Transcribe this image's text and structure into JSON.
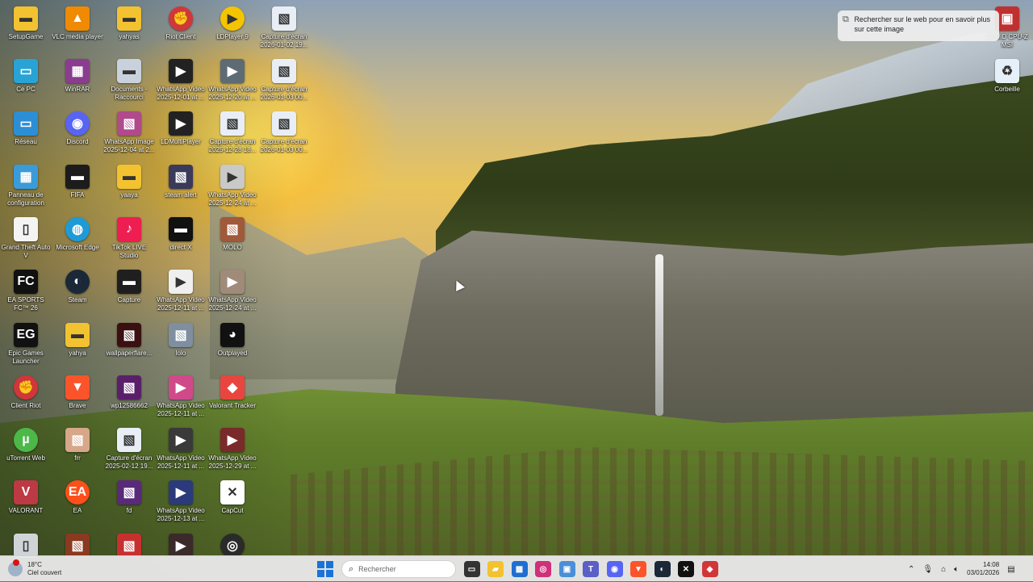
{
  "desktop": {
    "icons": [
      {
        "label": "SetupGame",
        "glyph": "folder-icon",
        "color": "#f2c230"
      },
      {
        "label": "VLC media player",
        "glyph": "vlc-icon",
        "color": "#f08a00"
      },
      {
        "label": "yahyas",
        "glyph": "folder-icon",
        "color": "#f2c230"
      },
      {
        "label": "Riot Client",
        "glyph": "riot-icon",
        "color": "#d13639"
      },
      {
        "label": "LDPlayer 9",
        "glyph": "ldplayer-icon",
        "color": "#f5c400"
      },
      {
        "label": "Capture d'écran 2026-01-02 19...",
        "glyph": "image-icon",
        "color": "#e9eef6"
      },
      {
        "label": "Ce PC",
        "glyph": "monitor-icon",
        "color": "#29a3d6"
      },
      {
        "label": "WinRAR",
        "glyph": "winrar-icon",
        "color": "#8a3d8e"
      },
      {
        "label": "Documents - Raccourci",
        "glyph": "folder-icon",
        "color": "#c9d2dc"
      },
      {
        "label": "WhatsApp Video 2025-12-01 at ...",
        "glyph": "video-icon",
        "color": "#222222"
      },
      {
        "label": "WhatsApp Video 2025-12-20 at ...",
        "glyph": "video-icon",
        "color": "#5f6b74"
      },
      {
        "label": "Capture d'écran 2026-01-03 00...",
        "glyph": "image-icon",
        "color": "#e9eef6"
      },
      {
        "label": "Réseau",
        "glyph": "network-icon",
        "color": "#2c8fd6"
      },
      {
        "label": "Discord",
        "glyph": "discord-icon",
        "color": "#5865f2"
      },
      {
        "label": "WhatsApp Image 2025-12-04 at 2...",
        "glyph": "image-icon",
        "color": "#b04a8a"
      },
      {
        "label": "LDMultiPlayer",
        "glyph": "ldmulti-icon",
        "color": "#222222"
      },
      {
        "label": "Capture d'écran 2025-12-28 18...",
        "glyph": "image-icon",
        "color": "#e9eef6"
      },
      {
        "label": "Capture d'écran 2026-01-03 00...",
        "glyph": "image-icon",
        "color": "#e9eef6"
      },
      {
        "label": "Panneau de configuration",
        "glyph": "control-panel-icon",
        "color": "#3a9bd9"
      },
      {
        "label": "FIFA",
        "glyph": "fifa-icon",
        "color": "#1c1c1c"
      },
      {
        "label": "yaaya",
        "glyph": "folder-icon",
        "color": "#f2c230"
      },
      {
        "label": "steam alert",
        "glyph": "image-icon",
        "color": "#3a3a5a"
      },
      {
        "label": "WhatsApp Video 2025-12-24 at ...",
        "glyph": "video-icon",
        "color": "#c9c9c9"
      },
      {
        "label": "Grand Theft Auto V",
        "glyph": "file-icon",
        "color": "#f4f4f4"
      },
      {
        "label": "Microsoft Edge",
        "glyph": "edge-icon",
        "color": "#1e9bd7"
      },
      {
        "label": "TikTok LIVE Studio",
        "glyph": "tiktok-icon",
        "color": "#ee1d52"
      },
      {
        "label": "direct X",
        "glyph": "directx-icon",
        "color": "#111111"
      },
      {
        "label": "MOLO",
        "glyph": "image-icon",
        "color": "#a05a3a"
      },
      {
        "label": "EA SPORTS FC™ 26",
        "glyph": "easports-icon",
        "color": "#111111"
      },
      {
        "label": "Steam",
        "glyph": "steam-icon",
        "color": "#1b2838"
      },
      {
        "label": "Capture",
        "glyph": "capture-icon",
        "color": "#1f1f1f"
      },
      {
        "label": "WhatsApp Video 2025-12-11 at ...",
        "glyph": "video-icon",
        "color": "#efefef"
      },
      {
        "label": "WhatsApp Video 2025-12-24 at ...",
        "glyph": "video-icon",
        "color": "#a08a7a"
      },
      {
        "label": "Epic Games Launcher",
        "glyph": "epic-icon",
        "color": "#111111"
      },
      {
        "label": "yahya",
        "glyph": "folder-icon",
        "color": "#f2c230"
      },
      {
        "label": "wallpaperflare...",
        "glyph": "image-icon",
        "color": "#3b1010"
      },
      {
        "label": "lolo",
        "glyph": "image-icon",
        "color": "#7f8fa0"
      },
      {
        "label": "Outplayed",
        "glyph": "outplayed-icon",
        "color": "#111111"
      },
      {
        "label": "Client Riot",
        "glyph": "riot-icon",
        "color": "#d13639"
      },
      {
        "label": "Brave",
        "glyph": "brave-icon",
        "color": "#fb542b"
      },
      {
        "label": "wp12586662",
        "glyph": "image-icon",
        "color": "#5a1f6a"
      },
      {
        "label": "WhatsApp Video 2025-12-11 at ...",
        "glyph": "video-icon",
        "color": "#d04a8a"
      },
      {
        "label": "Valorant Tracker",
        "glyph": "tracker-icon",
        "color": "#e9453f"
      },
      {
        "label": "uTorrent Web",
        "glyph": "utorrent-icon",
        "color": "#4cb848"
      },
      {
        "label": "frr",
        "glyph": "image-icon",
        "color": "#d7a78a"
      },
      {
        "label": "Capture d'écran 2025-02-12 19...",
        "glyph": "image-icon",
        "color": "#e9eef6"
      },
      {
        "label": "WhatsApp Video 2025-12-11 at ...",
        "glyph": "video-icon",
        "color": "#3a3a3a"
      },
      {
        "label": "WhatsApp Video 2025-12-29 at ...",
        "glyph": "video-icon",
        "color": "#7a2a2a"
      },
      {
        "label": "VALORANT",
        "glyph": "valorant-icon",
        "color": "#bd3944"
      },
      {
        "label": "EA",
        "glyph": "ea-icon",
        "color": "#ff4f1a"
      },
      {
        "label": "fd",
        "glyph": "image-icon",
        "color": "#5a2a7a"
      },
      {
        "label": "WhatsApp Video 2025-12-13 at ...",
        "glyph": "video-icon",
        "color": "#2a3a7a"
      },
      {
        "label": "CapCut",
        "glyph": "capcut-icon",
        "color": "#ffffff"
      },
      {
        "label": "",
        "glyph": "file-icon",
        "color": "#d0d4d8"
      },
      {
        "label": "",
        "glyph": "image-icon",
        "color": "#8a3a20"
      },
      {
        "label": "",
        "glyph": "image-icon",
        "color": "#c83030"
      },
      {
        "label": "",
        "glyph": "video-icon",
        "color": "#3a2a2a"
      },
      {
        "label": "",
        "glyph": "obs-icon",
        "color": "#2a2a2a"
      },
      {
        "label": "CPUID CPU-Z MSI",
        "glyph": "cpuz-icon",
        "color": "#c03030"
      },
      {
        "label": "Corbeille",
        "glyph": "recycle-bin-icon",
        "color": "#e6f0f8"
      }
    ]
  },
  "bing": {
    "text": "Rechercher sur le web pour en savoir plus sur cette image",
    "icon": "visual-search-icon"
  },
  "taskbar": {
    "weather": {
      "temp": "18°C",
      "condition": "Ciel couvert",
      "icon": "cloud-icon",
      "badge": "1"
    },
    "search_placeholder": "Rechercher",
    "apps": [
      {
        "name": "task-view",
        "color": "#333333",
        "glyph": "▭"
      },
      {
        "name": "file-explorer",
        "color": "#f2c230",
        "glyph": "▰"
      },
      {
        "name": "microsoft-store",
        "color": "#1f6fd1",
        "glyph": "▦"
      },
      {
        "name": "instagram",
        "color": "#d0307a",
        "glyph": "◎"
      },
      {
        "name": "screen-capture",
        "color": "#4a8fd8",
        "glyph": "▣"
      },
      {
        "name": "teams",
        "color": "#5b5fc7",
        "glyph": "T"
      },
      {
        "name": "discord",
        "color": "#5865f2",
        "glyph": "◉"
      },
      {
        "name": "brave",
        "color": "#fb542b",
        "glyph": "▼"
      },
      {
        "name": "steam",
        "color": "#1b2838",
        "glyph": "◐"
      },
      {
        "name": "capcut",
        "color": "#111111",
        "glyph": "✕"
      },
      {
        "name": "riot-client",
        "color": "#d13639",
        "glyph": "◆"
      }
    ],
    "tray": {
      "time": "14:08",
      "date": "03/01/2026"
    }
  }
}
